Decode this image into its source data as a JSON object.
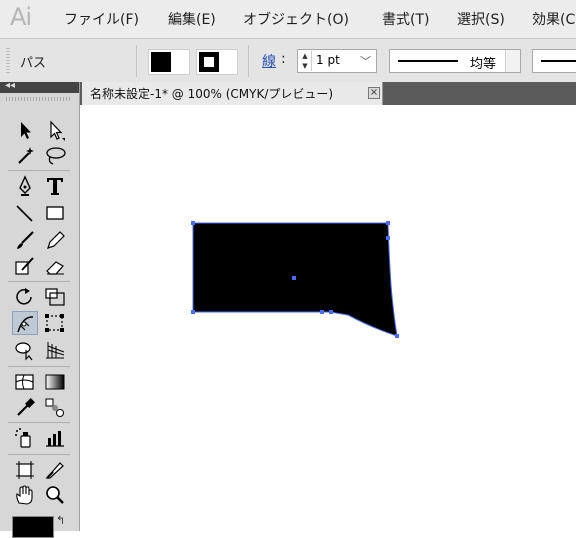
{
  "app": {
    "logo": "Ai"
  },
  "menu": {
    "items": [
      "ファイル(F)",
      "編集(E)",
      "オブジェクト(O)",
      "書式(T)",
      "選択(S)",
      "効果(C)"
    ]
  },
  "control": {
    "selection_label": "パス",
    "stroke_label": "線",
    "stroke_colon": ":",
    "stroke_weight": "1 pt",
    "profile_label": "均等"
  },
  "document": {
    "tab_title": "名称未設定-1* @ 100% (CMYK/プレビュー)",
    "close_glyph": "×"
  },
  "colors": {
    "path_fill": "#000000",
    "selection": "#4a6cf7",
    "active_tool": "#bfc9d6"
  },
  "tools": [
    "selection-tool",
    "direct-selection-tool",
    "magic-wand-tool",
    "lasso-tool",
    "pen-tool",
    "type-tool",
    "line-segment-tool",
    "rectangle-tool",
    "paintbrush-tool",
    "pencil-tool",
    "blob-brush-tool",
    "eraser-tool",
    "rotate-tool",
    "scale-tool",
    "width-tool",
    "free-transform-tool",
    "shape-builder-tool",
    "perspective-grid-tool",
    "mesh-tool",
    "gradient-tool",
    "eyedropper-tool",
    "blend-tool",
    "symbol-sprayer-tool",
    "column-graph-tool",
    "artboard-tool",
    "slice-tool",
    "hand-tool",
    "zoom-tool"
  ],
  "active_tool": "width-tool"
}
